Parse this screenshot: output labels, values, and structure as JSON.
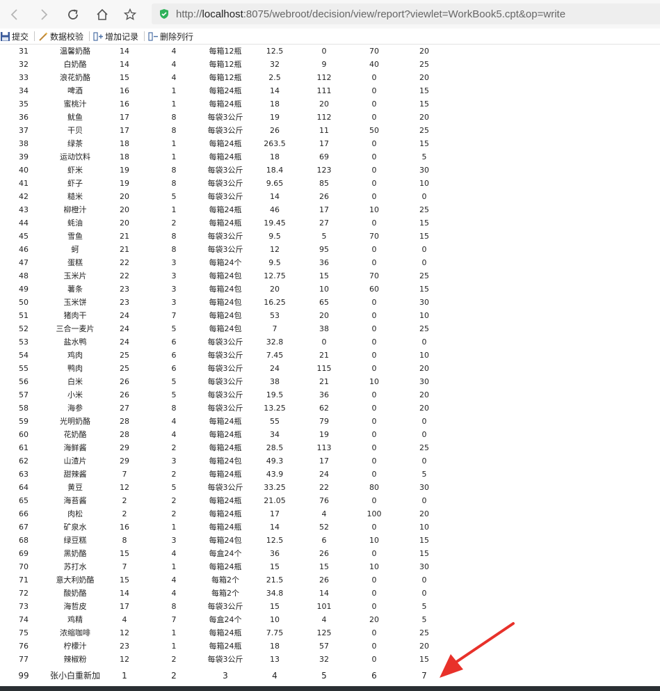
{
  "browser": {
    "url_scheme": "http://",
    "url_host": "localhost",
    "url_rest": ":8075/webroot/decision/view/report?viewlet=WorkBook5.cpt&op=write"
  },
  "toolbar": {
    "submit": "提交",
    "validate": "数据校验",
    "add_record": "增加记录",
    "delete_row": "删除列行"
  },
  "rows": [
    [
      "31",
      "温馨奶酪",
      "14",
      "4",
      "每箱12瓶",
      "12.5",
      "0",
      "70",
      "20"
    ],
    [
      "32",
      "白奶酪",
      "14",
      "4",
      "每箱12瓶",
      "32",
      "9",
      "40",
      "25"
    ],
    [
      "33",
      "浪花奶酪",
      "15",
      "4",
      "每箱12瓶",
      "2.5",
      "112",
      "0",
      "20"
    ],
    [
      "34",
      "啤酒",
      "16",
      "1",
      "每箱24瓶",
      "14",
      "111",
      "0",
      "15"
    ],
    [
      "35",
      "蜜桃汁",
      "16",
      "1",
      "每箱24瓶",
      "18",
      "20",
      "0",
      "15"
    ],
    [
      "36",
      "鱿鱼",
      "17",
      "8",
      "每袋3公斤",
      "19",
      "112",
      "0",
      "20"
    ],
    [
      "37",
      "干贝",
      "17",
      "8",
      "每袋3公斤",
      "26",
      "11",
      "50",
      "25"
    ],
    [
      "38",
      "绿茶",
      "18",
      "1",
      "每箱24瓶",
      "263.5",
      "17",
      "0",
      "15"
    ],
    [
      "39",
      "运动饮料",
      "18",
      "1",
      "每箱24瓶",
      "18",
      "69",
      "0",
      "5"
    ],
    [
      "40",
      "虾米",
      "19",
      "8",
      "每袋3公斤",
      "18.4",
      "123",
      "0",
      "30"
    ],
    [
      "41",
      "虾子",
      "19",
      "8",
      "每袋3公斤",
      "9.65",
      "85",
      "0",
      "10"
    ],
    [
      "42",
      "糙米",
      "20",
      "5",
      "每袋3公斤",
      "14",
      "26",
      "0",
      "0"
    ],
    [
      "43",
      "柳橙汁",
      "20",
      "1",
      "每箱24瓶",
      "46",
      "17",
      "10",
      "25"
    ],
    [
      "44",
      "蚝油",
      "20",
      "2",
      "每箱24瓶",
      "19.45",
      "27",
      "0",
      "15"
    ],
    [
      "45",
      "雪鱼",
      "21",
      "8",
      "每袋3公斤",
      "9.5",
      "5",
      "70",
      "15"
    ],
    [
      "46",
      "蚵",
      "21",
      "8",
      "每袋3公斤",
      "12",
      "95",
      "0",
      "0"
    ],
    [
      "47",
      "蛋糕",
      "22",
      "3",
      "每箱24个",
      "9.5",
      "36",
      "0",
      "0"
    ],
    [
      "48",
      "玉米片",
      "22",
      "3",
      "每箱24包",
      "12.75",
      "15",
      "70",
      "25"
    ],
    [
      "49",
      "薯条",
      "23",
      "3",
      "每箱24包",
      "20",
      "10",
      "60",
      "15"
    ],
    [
      "50",
      "玉米饼",
      "23",
      "3",
      "每箱24包",
      "16.25",
      "65",
      "0",
      "30"
    ],
    [
      "51",
      "猪肉干",
      "24",
      "7",
      "每箱24包",
      "53",
      "20",
      "0",
      "10"
    ],
    [
      "52",
      "三合一麦片",
      "24",
      "5",
      "每箱24包",
      "7",
      "38",
      "0",
      "25"
    ],
    [
      "53",
      "盐水鸭",
      "24",
      "6",
      "每袋3公斤",
      "32.8",
      "0",
      "0",
      "0"
    ],
    [
      "54",
      "鸡肉",
      "25",
      "6",
      "每袋3公斤",
      "7.45",
      "21",
      "0",
      "10"
    ],
    [
      "55",
      "鸭肉",
      "25",
      "6",
      "每袋3公斤",
      "24",
      "115",
      "0",
      "20"
    ],
    [
      "56",
      "白米",
      "26",
      "5",
      "每袋3公斤",
      "38",
      "21",
      "10",
      "30"
    ],
    [
      "57",
      "小米",
      "26",
      "5",
      "每袋3公斤",
      "19.5",
      "36",
      "0",
      "20"
    ],
    [
      "58",
      "海参",
      "27",
      "8",
      "每袋3公斤",
      "13.25",
      "62",
      "0",
      "20"
    ],
    [
      "59",
      "光明奶酪",
      "28",
      "4",
      "每箱24瓶",
      "55",
      "79",
      "0",
      "0"
    ],
    [
      "60",
      "花奶酪",
      "28",
      "4",
      "每箱24瓶",
      "34",
      "19",
      "0",
      "0"
    ],
    [
      "61",
      "海鲜酱",
      "29",
      "2",
      "每箱24瓶",
      "28.5",
      "113",
      "0",
      "25"
    ],
    [
      "62",
      "山渣片",
      "29",
      "3",
      "每箱24包",
      "49.3",
      "17",
      "0",
      "0"
    ],
    [
      "63",
      "甜辣酱",
      "7",
      "2",
      "每箱24瓶",
      "43.9",
      "24",
      "0",
      "5"
    ],
    [
      "64",
      "黄豆",
      "12",
      "5",
      "每袋3公斤",
      "33.25",
      "22",
      "80",
      "30"
    ],
    [
      "65",
      "海苔酱",
      "2",
      "2",
      "每箱24瓶",
      "21.05",
      "76",
      "0",
      "0"
    ],
    [
      "66",
      "肉松",
      "2",
      "2",
      "每箱24瓶",
      "17",
      "4",
      "100",
      "20"
    ],
    [
      "67",
      "矿泉水",
      "16",
      "1",
      "每箱24瓶",
      "14",
      "52",
      "0",
      "10"
    ],
    [
      "68",
      "绿豆糕",
      "8",
      "3",
      "每箱24包",
      "12.5",
      "6",
      "10",
      "15"
    ],
    [
      "69",
      "黑奶酪",
      "15",
      "4",
      "每盒24个",
      "36",
      "26",
      "0",
      "15"
    ],
    [
      "70",
      "苏打水",
      "7",
      "1",
      "每箱24瓶",
      "15",
      "15",
      "10",
      "30"
    ],
    [
      "71",
      "意大利奶酪",
      "15",
      "4",
      "每箱2个",
      "21.5",
      "26",
      "0",
      "0"
    ],
    [
      "72",
      "酸奶酪",
      "14",
      "4",
      "每箱2个",
      "34.8",
      "14",
      "0",
      "0"
    ],
    [
      "73",
      "海哲皮",
      "17",
      "8",
      "每袋3公斤",
      "15",
      "101",
      "0",
      "5"
    ],
    [
      "74",
      "鸡精",
      "4",
      "7",
      "每盒24个",
      "10",
      "4",
      "20",
      "5"
    ],
    [
      "75",
      "浓缩咖啡",
      "12",
      "1",
      "每箱24瓶",
      "7.75",
      "125",
      "0",
      "25"
    ],
    [
      "76",
      "柠檬汁",
      "23",
      "1",
      "每箱24瓶",
      "18",
      "57",
      "0",
      "20"
    ],
    [
      "77",
      "辣椒粉",
      "12",
      "2",
      "每袋3公斤",
      "13",
      "32",
      "0",
      "15"
    ]
  ],
  "new_row": [
    "99",
    "张小白重新加",
    "1",
    "2",
    "3",
    "4",
    "5",
    "6",
    "7"
  ],
  "colors": {
    "arrow": "#e8312a",
    "shield": "#2fb15a"
  }
}
